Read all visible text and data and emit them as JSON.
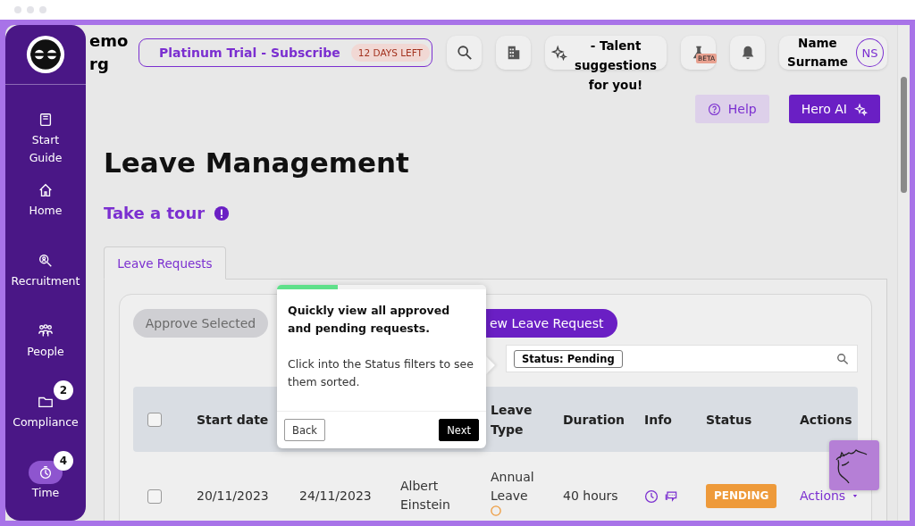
{
  "org_name": [
    "emo",
    "rg"
  ],
  "trial": {
    "label": "Platinum Trial - Subscribe",
    "badge": "12 DAYS LEFT"
  },
  "toolbar": [
    {
      "kind": "search"
    },
    {
      "kind": "building"
    },
    {
      "kind": "smartmatch",
      "label": "- Talent suggestions for you!"
    },
    {
      "kind": "beta",
      "badge": "BETA"
    },
    {
      "kind": "bell"
    }
  ],
  "user": {
    "name": "Name Surname",
    "initials": "NS"
  },
  "help_button": "Help",
  "ai_button": "Hero AI",
  "sidebar": {
    "items": [
      {
        "label": "Start Guide",
        "selected": false
      },
      {
        "label": "Home",
        "selected": false
      },
      {
        "label": "Recruitment",
        "selected": false
      },
      {
        "label": "People",
        "selected": false
      },
      {
        "label": "Compliance",
        "badge": "2",
        "selected": false
      },
      {
        "label": "Time",
        "badge": "4",
        "selected": true
      }
    ]
  },
  "page_title": "Leave Management",
  "tour_link": "Take a tour",
  "tabs": [
    {
      "label": "Leave Requests",
      "selected": true
    }
  ],
  "approve_button": {
    "label": "Approve Selected",
    "disabled": true
  },
  "new_button": "ew Leave Request",
  "search": {
    "filter_chip": "Status: Pending"
  },
  "table": {
    "columns": [
      {
        "kind": "checkbox",
        "checked": false
      },
      {
        "kind": "text",
        "label": "Start date"
      },
      {
        "kind": "covered"
      },
      {
        "kind": "covered"
      },
      {
        "kind": "text",
        "label": "Leave Type"
      },
      {
        "kind": "text",
        "label": "Duration"
      },
      {
        "kind": "text",
        "label": "Info"
      },
      {
        "kind": "text",
        "label": "Status"
      },
      {
        "kind": "text",
        "label": "Actions"
      }
    ],
    "rows": [
      {
        "checked": false,
        "start": "20/11/2023",
        "end": "24/11/2023",
        "employee": "Albert Einstein",
        "leave_type": "Annual Leave",
        "duration": "40 hours",
        "status": "PENDING",
        "color": "#ee9a3a",
        "action": "Actions"
      }
    ]
  },
  "tour_popover": {
    "title": "Quickly view all approved and pending requests.",
    "body": "Click into the Status filters to see them sorted.",
    "level": 0.29,
    "back": "Back",
    "next": "Next"
  }
}
